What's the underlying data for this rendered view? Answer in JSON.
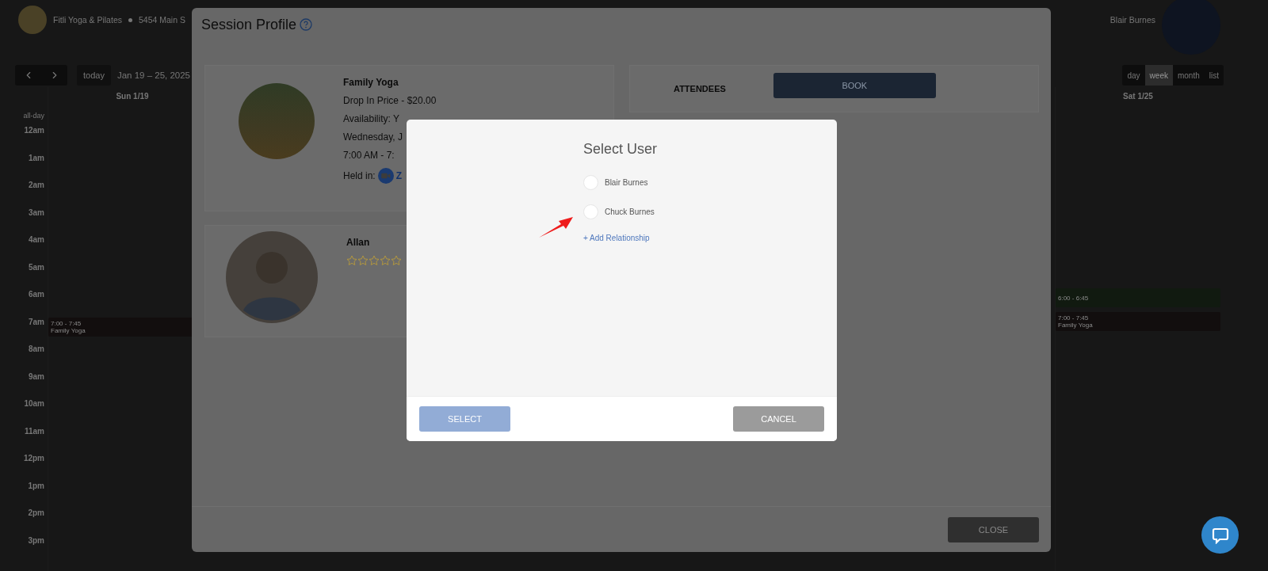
{
  "header": {
    "studio": "Fitli Yoga & Pilates",
    "address": "5454 Main S",
    "user": "Blair Burnes"
  },
  "calendar": {
    "today": "today",
    "range": "Jan 19 – 25, 2025",
    "all_day": "all-day",
    "views": [
      {
        "label": "day",
        "selected": false
      },
      {
        "label": "week",
        "selected": true
      },
      {
        "label": "month",
        "selected": false
      },
      {
        "label": "list",
        "selected": false
      }
    ],
    "hours": [
      "12am",
      "1am",
      "2am",
      "3am",
      "4am",
      "5am",
      "6am",
      "7am",
      "8am",
      "9am",
      "10am",
      "11am",
      "12pm",
      "1pm",
      "2pm",
      "3pm"
    ],
    "days": [
      {
        "label": "Sun 1/19",
        "events": [
          {
            "time": "7:00 - 7:45",
            "title": "Family Yoga",
            "color": "#120e0e"
          }
        ]
      },
      {
        "label": "Sat 1/25",
        "events": [
          {
            "time": "6:00 - 6:45",
            "color": "#111a10"
          },
          {
            "time": "7:00 - 7:45",
            "title": "Family Yoga",
            "color": "#120e0e"
          }
        ]
      }
    ]
  },
  "session": {
    "title": "Session Profile",
    "class_card": {
      "name": "Family Yoga",
      "lines": [
        "Drop In Price - $20.00",
        "Availability: Y",
        "Wednesday, J",
        "7:00 AM - 7:"
      ],
      "held_in_label": "Held in:",
      "held_in_value": "Z"
    },
    "instructor": {
      "name": "Allan",
      "stars": 0
    },
    "attendees": {
      "title": "ATTENDEES",
      "button": "BOOK"
    },
    "close": "CLOSE"
  },
  "dialog": {
    "title": "Select User",
    "users": [
      {
        "name": "Blair Burnes",
        "selected": false
      },
      {
        "name": "Chuck Burnes",
        "selected": false
      }
    ],
    "add_link": "+ Add Relationship",
    "select_button": {
      "label": "SELECT",
      "disabled": true
    },
    "cancel_button": "CANCEL"
  }
}
